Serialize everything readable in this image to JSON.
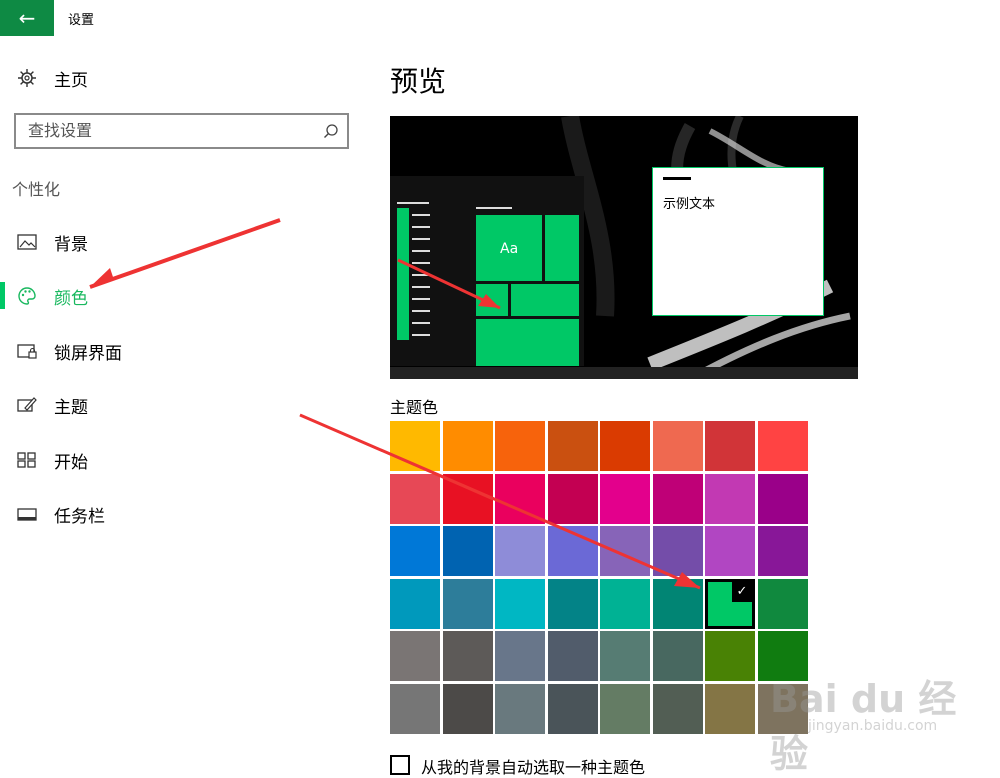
{
  "app": {
    "back_icon": "arrow-left-icon",
    "title": "设置"
  },
  "sidebar": {
    "home": {
      "label": "主页",
      "icon": "gear-icon"
    },
    "search": {
      "placeholder": "查找设置",
      "icon": "search-icon"
    },
    "section_title": "个性化",
    "items": [
      {
        "label": "背景",
        "icon": "image-icon"
      },
      {
        "label": "颜色",
        "icon": "palette-icon",
        "selected": true
      },
      {
        "label": "锁屏界面",
        "icon": "lock-screen-icon"
      },
      {
        "label": "主题",
        "icon": "theme-brush-icon"
      },
      {
        "label": "开始",
        "icon": "start-grid-icon"
      },
      {
        "label": "任务栏",
        "icon": "taskbar-icon"
      }
    ],
    "accent_color": "#00c866"
  },
  "main": {
    "preview_title": "预览",
    "sample_text": "示例文本",
    "preview_tile_label": "Aa",
    "theme_color_label": "主题色",
    "selected_color": "#00c866",
    "colors": [
      [
        "#ffb900",
        "#ff8c00",
        "#f7630c",
        "#ca5010",
        "#da3b01",
        "#ef6950",
        "#d13438",
        "#ff4343"
      ],
      [
        "#e74856",
        "#e81123",
        "#ea005e",
        "#c30052",
        "#e3008c",
        "#bf0077",
        "#c239b3",
        "#9a0089"
      ],
      [
        "#0078d7",
        "#0063b1",
        "#8e8cd8",
        "#6b69d6",
        "#8764b8",
        "#744da9",
        "#b146c2",
        "#881798"
      ],
      [
        "#0099bc",
        "#2d7d9a",
        "#00b7c3",
        "#038387",
        "#00b294",
        "#018574",
        "#00c866",
        "#10893e"
      ],
      [
        "#7a7574",
        "#5d5a58",
        "#68768a",
        "#515c6b",
        "#567c73",
        "#486860",
        "#498205",
        "#107c10"
      ],
      [
        "#767676",
        "#4c4a48",
        "#69797e",
        "#4a5459",
        "#647c64",
        "#525e54",
        "#847545",
        "#7e735f"
      ]
    ],
    "auto_pick_label": "从我的背景自动选取一种主题色"
  },
  "watermark": {
    "line1": "Bai du 经验",
    "line2": "jingyan.baidu.com"
  }
}
